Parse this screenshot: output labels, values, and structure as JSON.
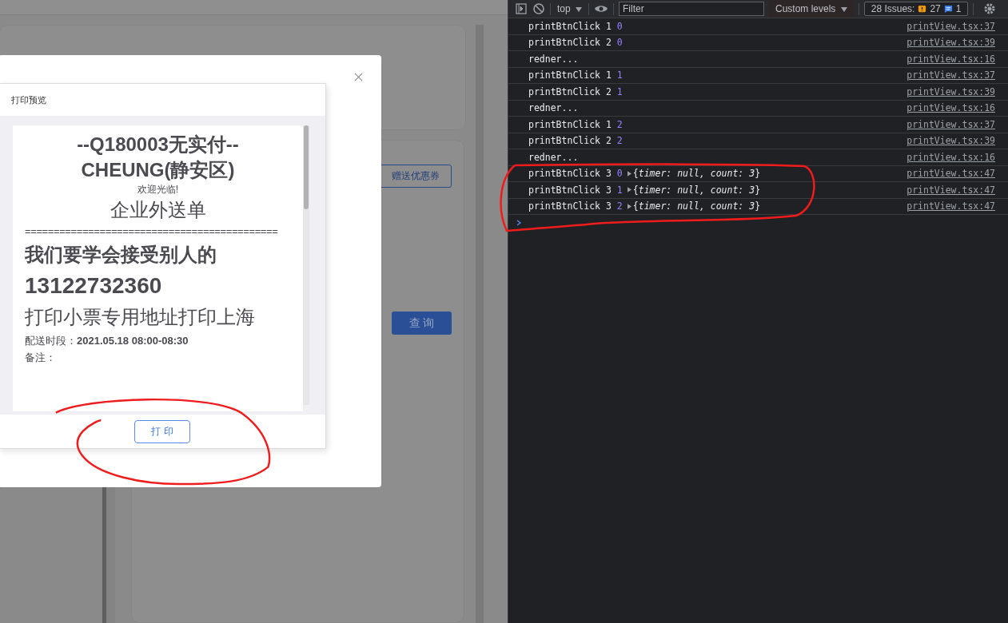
{
  "page": {
    "buttons": [
      {
        "label": "赠送优惠券",
        "kind": "outline"
      },
      {
        "label": "查 询",
        "kind": "primary"
      }
    ]
  },
  "modal": {
    "title": "打印预览",
    "receipt": [
      {
        "kind": "title",
        "text": "--Q180003无实付--"
      },
      {
        "kind": "title",
        "text": "CHEUNG(静安区)"
      },
      {
        "kind": "small",
        "text": "欢迎光临!"
      },
      {
        "kind": "heading",
        "text": "企业外送单"
      },
      {
        "kind": "rule",
        "text": "============================================"
      },
      {
        "kind": "large",
        "text": "我们要学会接受别人的"
      },
      {
        "kind": "number",
        "text": "13122732360"
      },
      {
        "kind": "address",
        "text": "打印小票专用地址打印上海"
      },
      {
        "kind": "field",
        "text": "配送时段：**2021.05.18 08:00-08:30**"
      },
      {
        "kind": "field",
        "text": "备注："
      }
    ],
    "print_button": "打 印"
  },
  "devtools": {
    "toolbar": {
      "context": "top",
      "filter_placeholder": "Filter",
      "levels": "Custom levels",
      "issues": "28 Issues:",
      "warnings": "27",
      "infos": "1"
    },
    "messages": [
      {
        "text": "printBtnClick 1",
        "value": "0",
        "link": "printView.tsx:37"
      },
      {
        "text": "printBtnClick 2",
        "value": "0",
        "link": "printView.tsx:39"
      },
      {
        "text": "redner...",
        "link": "printView.tsx:16"
      },
      {
        "text": "printBtnClick 1",
        "value": "1",
        "link": "printView.tsx:37"
      },
      {
        "text": "printBtnClick 2",
        "value": "1",
        "link": "printView.tsx:39"
      },
      {
        "text": "redner...",
        "link": "printView.tsx:16"
      },
      {
        "text": "printBtnClick 1",
        "value": "2",
        "link": "printView.tsx:37"
      },
      {
        "text": "printBtnClick 2",
        "value": "2",
        "link": "printView.tsx:39"
      },
      {
        "text": "redner...",
        "link": "printView.tsx:16"
      },
      {
        "text": "printBtnClick 3",
        "value": "0",
        "object": "{*timer: null, count: 3*}",
        "link": "printView.tsx:47"
      },
      {
        "text": "printBtnClick 3",
        "value": "1",
        "object": "{*timer: null, count: 3*}",
        "link": "printView.tsx:47"
      },
      {
        "text": "printBtnClick 3",
        "value": "2",
        "object": "{*timer: null, count: 3*}",
        "link": "printView.tsx:47"
      }
    ]
  }
}
